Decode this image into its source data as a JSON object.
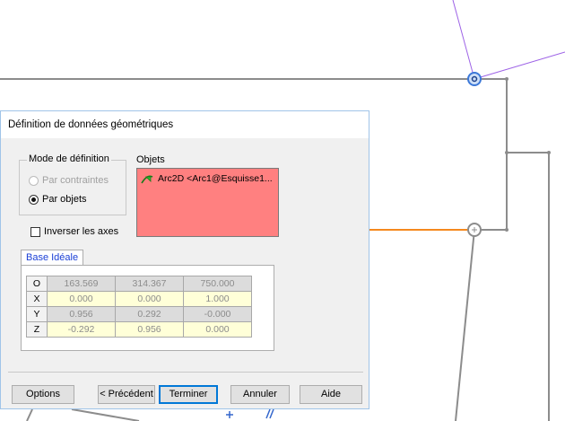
{
  "dialog": {
    "title": "Définition de données géométriques",
    "mode_group": {
      "label": "Mode de définition",
      "option_constraints": "Par contraintes",
      "option_objects": "Par objets",
      "selected": "Par objets"
    },
    "invert_axes": {
      "label": "Inverser les axes",
      "checked": false
    },
    "objects": {
      "label": "Objets",
      "items": [
        "Arc2D <Arc1@Esquisse1..."
      ],
      "background_color": "#ff8080"
    },
    "tab_label": "Base Idéale",
    "grid": {
      "rows": [
        {
          "label": "O",
          "values": [
            "163.569",
            "314.367",
            "750.000"
          ]
        },
        {
          "label": "X",
          "values": [
            "0.000",
            "0.000",
            "1.000"
          ]
        },
        {
          "label": "Y",
          "values": [
            "0.956",
            "0.292",
            "-0.000"
          ]
        },
        {
          "label": "Z",
          "values": [
            "-0.292",
            "0.956",
            "0.000"
          ]
        }
      ]
    },
    "buttons": {
      "options": "Options",
      "previous": "< Précédent",
      "finish": "Terminer",
      "cancel": "Annuler",
      "help": "Aide"
    }
  },
  "colors": {
    "sketch_line": "#8c8c8c",
    "highlight_line": "#f5891e",
    "construction_line": "#9d62e6",
    "selected_point": "#3c78d8",
    "button_focus": "#0078d7"
  }
}
